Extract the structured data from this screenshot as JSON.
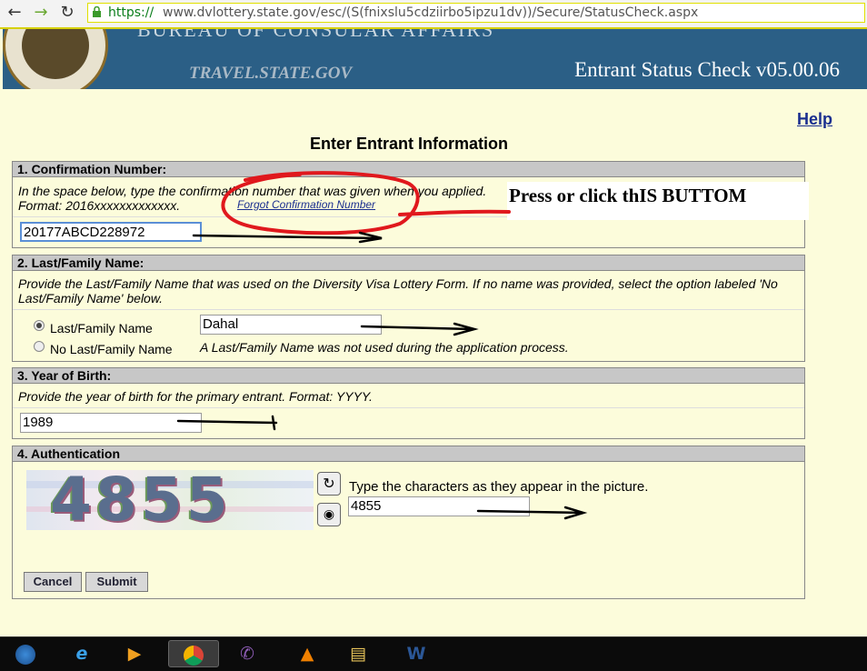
{
  "browser": {
    "url_scheme": "https://",
    "url_rest": "www.dvlottery.state.gov/esc/(S(fnixslu5cdziirbo5ipzu1dv))/Secure/StatusCheck.aspx",
    "back_icon": "arrow-left-icon",
    "forward_icon": "arrow-right-icon",
    "reload_icon": "reload-icon"
  },
  "banner": {
    "bureau_text": "BUREAU OF CONSULAR AFFAIRS",
    "site": "TRAVEL.STATE.GOV",
    "title": "Entrant Status Check v05.00.06"
  },
  "help_label": "Help",
  "page_heading": "Enter Entrant Information",
  "section1": {
    "header": "1. Confirmation Number:",
    "instruction_line1": "In the space below, type the confirmation number that was given when you applied.",
    "instruction_line2": "Format: 2016xxxxxxxxxxxxx.",
    "forgot_link": "Forgot Confirmation Number",
    "value": "20177ABCD228972"
  },
  "annotation_note": "Press  or click thIS BUTTOM",
  "section2": {
    "header": "2. Last/Family Name:",
    "instruction_line1": "Provide the Last/Family Name that was used on the Diversity Visa Lottery Form. If no name was provided, select the option labeled 'No",
    "instruction_line2": "Last/Family Name' below.",
    "option1_label": "Last/Family Name",
    "option2_label": "No Last/Family Name",
    "value": "Dahal",
    "option2_note": "A Last/Family Name was not used during the application process.",
    "selected": "Last/Family Name"
  },
  "section3": {
    "header": "3. Year of Birth:",
    "instruction": "Provide the year of birth for the primary entrant. Format: YYYY.",
    "value": "1989"
  },
  "section4": {
    "header": "4. Authentication",
    "captcha_text": "4855",
    "prompt": "Type the characters as they appear in the picture.",
    "value": "4855",
    "refresh_icon": "refresh-icon",
    "audio_icon": "audio-icon",
    "cancel_label": "Cancel",
    "submit_label": "Submit"
  },
  "taskbar": {
    "items": [
      "windows-start-icon",
      "internet-explorer-icon",
      "media-player-icon",
      "chrome-icon",
      "viber-icon",
      "vlc-icon",
      "file-explorer-icon",
      "word-icon"
    ]
  },
  "colors": {
    "banner": "#2b5f86",
    "page_background": "#fcfcdb",
    "section_header": "#c7c7c7",
    "annotation": "#e0181d"
  }
}
